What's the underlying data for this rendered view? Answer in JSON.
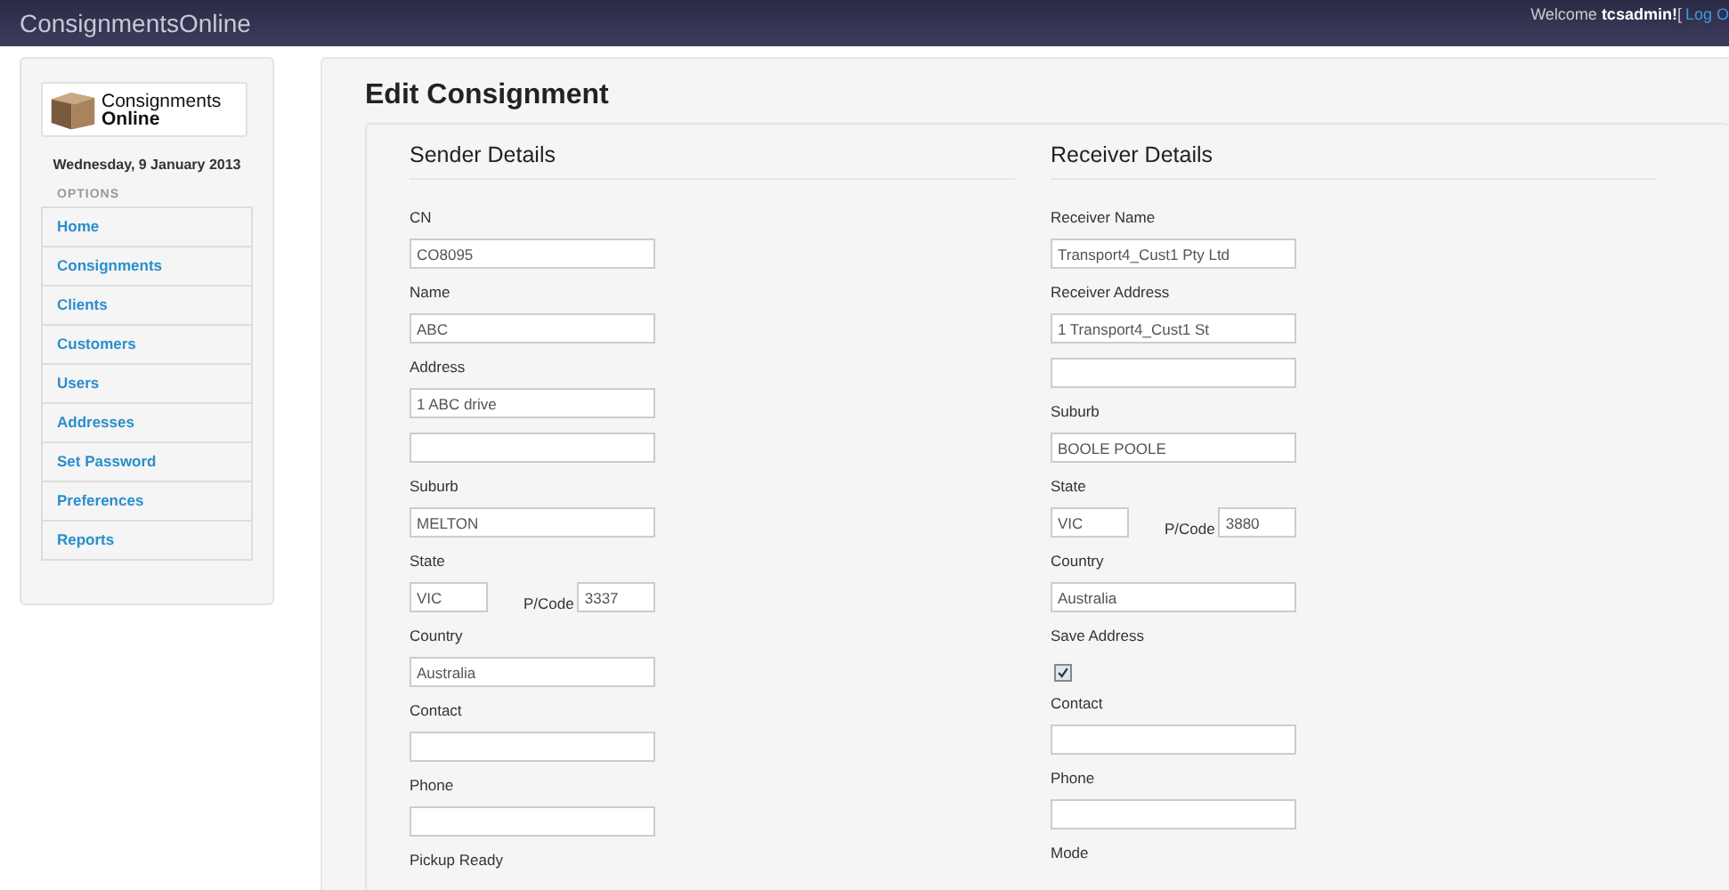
{
  "top_bar": {
    "brand": "ConsignmentsOnline",
    "welcome": "Welcome **tcsadmin!**[",
    "logout_link": "Log O"
  },
  "sidebar": {
    "logo": {
      "line1": "Consignments",
      "line2": "Online"
    },
    "date": "Wednesday, 9 January 2013",
    "section_heading": "OPTIONS",
    "items": [
      {
        "label": "Home"
      },
      {
        "label": "Consignments"
      },
      {
        "label": "Clients"
      },
      {
        "label": "Customers"
      },
      {
        "label": "Users"
      },
      {
        "label": "Addresses"
      },
      {
        "label": "Set Password"
      },
      {
        "label": "Preferences"
      },
      {
        "label": "Reports"
      }
    ]
  },
  "page": {
    "title": "Edit Consignment",
    "columns": [
      {
        "heading": "Sender Details",
        "fields": [
          {
            "kind": "text",
            "label": "CN",
            "value": "CO8095"
          },
          {
            "kind": "text",
            "label": "Name",
            "value": "ABC"
          },
          {
            "kind": "address",
            "label": "Address",
            "value": "1 ABC drive"
          },
          {
            "kind": "text",
            "label": "Suburb",
            "value": "MELTON"
          },
          {
            "kind": "state_pcode",
            "label": "State",
            "state": "VIC",
            "pcode_label": "P/Code",
            "pcode": "3337"
          },
          {
            "kind": "text",
            "label": "Country",
            "value": "Australia"
          },
          {
            "kind": "text",
            "label": "Contact"
          },
          {
            "kind": "text",
            "label": "Phone"
          },
          {
            "kind": "label_only",
            "label": "Pickup Ready"
          }
        ]
      },
      {
        "heading": "Receiver Details",
        "fields": [
          {
            "kind": "text",
            "label": "Receiver Name",
            "value": "Transport4_Cust1 Pty Ltd"
          },
          {
            "kind": "address",
            "label": "Receiver Address",
            "value": "1 Transport4_Cust1 St"
          },
          {
            "kind": "text",
            "label": "Suburb",
            "value": "BOOLE POOLE"
          },
          {
            "kind": "state_pcode",
            "label": "State",
            "state": "VIC",
            "pcode_label": "P/Code",
            "pcode": "3880"
          },
          {
            "kind": "text",
            "label": "Country",
            "value": "Australia"
          },
          {
            "kind": "checkbox",
            "label": "Save Address",
            "checked": true
          },
          {
            "kind": "text",
            "label": "Contact"
          },
          {
            "kind": "text",
            "label": "Phone"
          },
          {
            "kind": "label_only",
            "label": "Mode"
          }
        ]
      }
    ]
  }
}
